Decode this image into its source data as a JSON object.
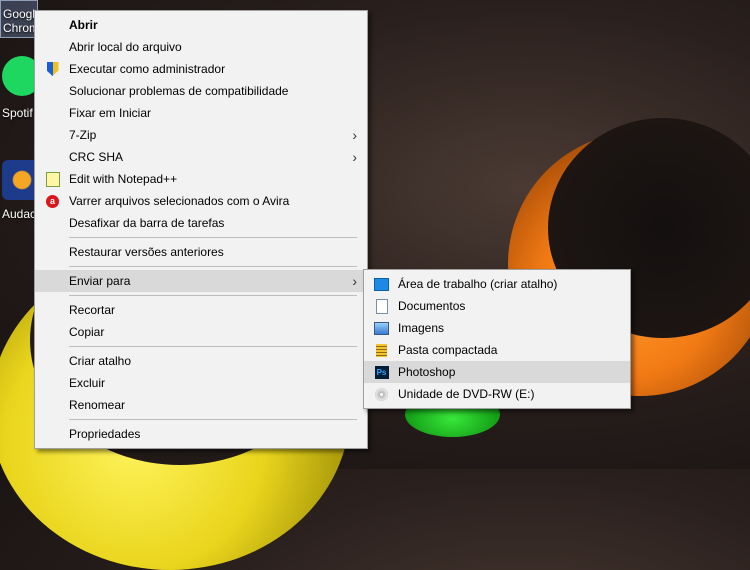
{
  "desktop": {
    "icons": [
      {
        "label": "Google Chrome",
        "line1": "Google",
        "line2": "Chrom"
      },
      {
        "label": "Spotify",
        "line1": "Spotif"
      },
      {
        "label": "Audacity",
        "line1": "Audaci"
      }
    ]
  },
  "context_menu": {
    "items": [
      {
        "label": "Abrir",
        "bold": true
      },
      {
        "label": "Abrir local do arquivo"
      },
      {
        "label": "Executar como administrador",
        "icon": "uac-shield-icon"
      },
      {
        "label": "Solucionar problemas de compatibilidade"
      },
      {
        "label": "Fixar em Iniciar"
      },
      {
        "label": "7-Zip",
        "submenu": true
      },
      {
        "label": "CRC SHA",
        "submenu": true
      },
      {
        "label": "Edit with Notepad++",
        "icon": "notepad-plus-plus-icon"
      },
      {
        "label": "Varrer arquivos selecionados com o Avira",
        "icon": "avira-icon"
      },
      {
        "label": "Desafixar da barra de tarefas"
      },
      {
        "label": "Restaurar versões anteriores"
      },
      {
        "label": "Enviar para",
        "submenu": true,
        "highlighted": true
      },
      {
        "label": "Recortar"
      },
      {
        "label": "Copiar"
      },
      {
        "label": "Criar atalho"
      },
      {
        "label": "Excluir"
      },
      {
        "label": "Renomear"
      },
      {
        "label": "Propriedades"
      }
    ]
  },
  "send_to_menu": {
    "items": [
      {
        "label": "Área de trabalho (criar atalho)",
        "icon": "desktop-icon"
      },
      {
        "label": "Documentos",
        "icon": "documents-icon"
      },
      {
        "label": "Imagens",
        "icon": "images-icon"
      },
      {
        "label": "Pasta compactada",
        "icon": "zip-folder-icon"
      },
      {
        "label": "Photoshop",
        "icon": "photoshop-icon",
        "highlighted": true,
        "icon_text": "Ps"
      },
      {
        "label": "Unidade de DVD-RW (E:)",
        "icon": "dvd-drive-icon"
      }
    ]
  },
  "colors": {
    "menu_bg": "#f2f2f2",
    "highlight": "#d9d9d9"
  }
}
